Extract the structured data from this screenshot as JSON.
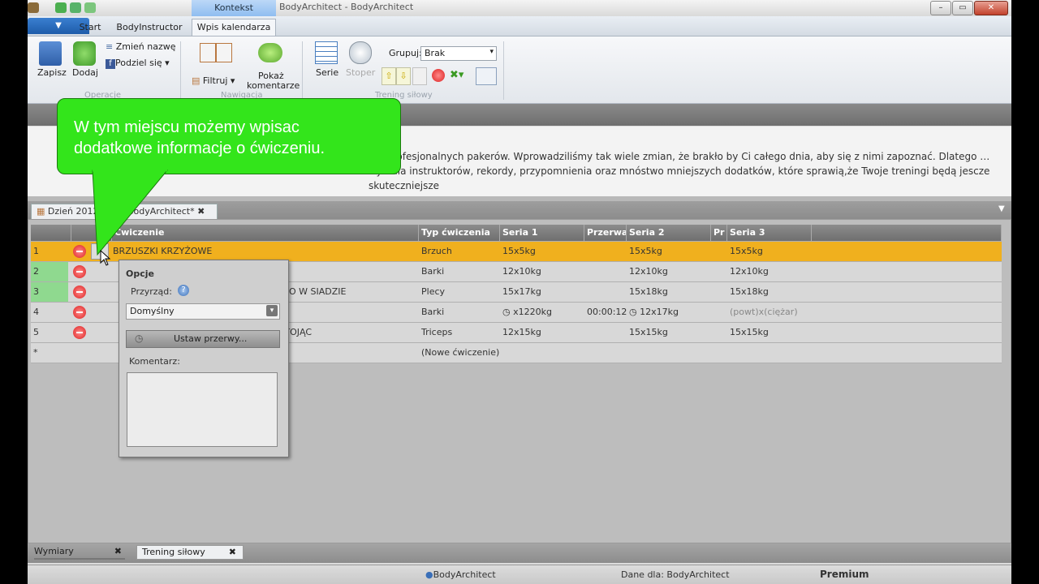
{
  "window": {
    "title": "BodyArchitect - BodyArchitect",
    "context_tab": "Kontekst"
  },
  "ribbon_tabs": [
    "Start",
    "BodyInstructor",
    "Wpis kalendarza"
  ],
  "ribbon": {
    "save": "Zapisz",
    "add": "Dodaj",
    "rename": "Zmień nazwę",
    "share": "Podziel się",
    "group_ops": "Operacje",
    "filter": "Filtruj",
    "show_comments_1": "Pokaż",
    "show_comments_2": "komentarze",
    "group_nav": "Nawigacja",
    "series": "Serie",
    "stopwatch": "Stoper",
    "group_by_label": "Grupuj:",
    "group_by_value": "Brak",
    "group_training": "Trening siłowy"
  },
  "description": "dla profesjonalnych pakerów. Wprowadziliśmy tak wiele zmian, że brakło by Ci całego dnia, aby się z nimi zapoznać. Dlatego …tryb dla instruktorów, rekordy, przypomnienia oraz mnóstwo mniejszych dodatków, które sprawią,że Twoje treningi będą jescze skuteczniejsze",
  "doc_tabs": {
    "day": "Dzień 2012…",
    "app": "BodyArchitect*"
  },
  "grid": {
    "headers": [
      "Ćwiczenie",
      "Typ ćwiczenia",
      "Seria 1",
      "Przerwa",
      "Seria 2",
      "Pr",
      "Seria 3"
    ],
    "rows": [
      {
        "n": "1",
        "exercise": "BRZUSZKI KRZYŻOWE",
        "type": "Brzuch",
        "s1": "15x5kg",
        "rest": "",
        "s2": "15x5kg",
        "s3": "15x5kg"
      },
      {
        "n": "2",
        "exercise": "",
        "type": "Barki",
        "s1": "12x10kg",
        "rest": "",
        "s2": "12x10kg",
        "s3": "12x10kg"
      },
      {
        "n": "3",
        "exercise": "ÓRNEGO W SIADZIE",
        "type": "Plecy",
        "s1": "15x17kg",
        "rest": "",
        "s2": "15x18kg",
        "s3": "15x18kg"
      },
      {
        "n": "4",
        "exercise": "",
        "type": "Barki",
        "s1": "x1220kg",
        "rest": "00:00:12",
        "s2": "12x17kg",
        "s3": "(powt)x(ciężar)"
      },
      {
        "n": "5",
        "exercise": "AGU STOJĄC",
        "type": "Triceps",
        "s1": "12x15kg",
        "rest": "",
        "s2": "15x15kg",
        "s3": "15x15kg"
      }
    ],
    "new_row_marker": "*",
    "new_row_text": "(Nowe ćwiczenie)"
  },
  "popup": {
    "title": "Opcje",
    "assign_label": "Przyrząd:",
    "assign_value": "Domyślny",
    "set_breaks": "Ustaw przerwy...",
    "comment_label": "Komentarz:"
  },
  "callout": {
    "line1": "W tym miejscu możemy wpisac",
    "line2": "dodatkowe informacje o ćwiczeniu."
  },
  "bottom_tabs": [
    "Wymiary",
    "Trening siłowy"
  ],
  "status": {
    "user": "BodyArchitect",
    "data_for": "Dane dla: BodyArchitect",
    "tier": "Premium"
  },
  "colors": {
    "selected_row": "#f0b01e",
    "callout": "#33e51b",
    "row_index_green": "#8fd98f"
  }
}
